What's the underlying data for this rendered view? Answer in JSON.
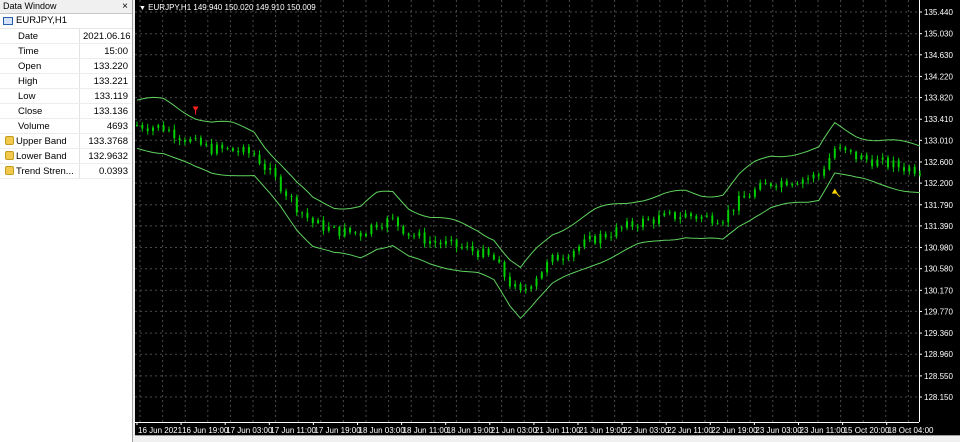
{
  "data_window": {
    "title": "Data Window",
    "close_label": "×",
    "symbol": "EURJPY,H1",
    "rows": [
      {
        "label": "Date",
        "value": "2021.06.16"
      },
      {
        "label": "Time",
        "value": "15:00"
      },
      {
        "label": "Open",
        "value": "133.220"
      },
      {
        "label": "High",
        "value": "133.221"
      },
      {
        "label": "Low",
        "value": "133.119"
      },
      {
        "label": "Close",
        "value": "133.136"
      },
      {
        "label": "Volume",
        "value": "4693"
      }
    ],
    "indicators": [
      {
        "label": "Upper Band",
        "value": "133.3768",
        "icon": "indicator-icon"
      },
      {
        "label": "Lower Band",
        "value": "132.9632",
        "icon": "indicator-icon"
      },
      {
        "label": "Trend Stren...",
        "value": "0.0393",
        "icon": "indicator-icon"
      }
    ]
  },
  "chart": {
    "header": "EURJPY,H1  149.940 150.020 149.910 150.009",
    "price_labels": [
      "135.440",
      "135.030",
      "134.630",
      "134.220",
      "133.820",
      "133.410",
      "133.010",
      "132.600",
      "132.200",
      "131.790",
      "131.390",
      "130.980",
      "130.580",
      "130.170",
      "129.770",
      "129.360",
      "128.960",
      "128.550",
      "128.150"
    ],
    "time_labels": [
      "16 Jun 2021",
      "16 Jun 19:00",
      "17 Jun 03:00",
      "17 Jun 11:00",
      "17 Jun 19:00",
      "18 Jun 03:00",
      "18 Jun 11:00",
      "18 Jun 19:00",
      "21 Jun 03:00",
      "21 Jun 11:00",
      "21 Jun 19:00",
      "22 Jun 03:00",
      "22 Jun 11:00",
      "22 Jun 19:00",
      "23 Jun 03:00",
      "23 Jun 11:00",
      "15 Oct 20:00",
      "18 Oct 04:00"
    ],
    "colors": {
      "background": "#000000",
      "grid": "#4a4a4a",
      "candle": "#00d000",
      "band": "#5fd35f",
      "axis_text": "#ffffff",
      "arrow_sell": "#ff2020",
      "arrow_buy": "#ffd700"
    }
  },
  "chart_data": {
    "type": "candlestick",
    "symbol": "EURJPY",
    "timeframe": "H1",
    "y_range": [
      128.15,
      135.44
    ],
    "grid": true,
    "center_path": [
      [
        0,
        133.3
      ],
      [
        5,
        133.25
      ],
      [
        8,
        133.1
      ],
      [
        11,
        132.95
      ],
      [
        14,
        132.85
      ],
      [
        18,
        132.82
      ],
      [
        22,
        132.75
      ],
      [
        24,
        132.5
      ],
      [
        27,
        132.15
      ],
      [
        30,
        131.75
      ],
      [
        33,
        131.45
      ],
      [
        37,
        131.3
      ],
      [
        42,
        131.25
      ],
      [
        45,
        131.45
      ],
      [
        48,
        131.5
      ],
      [
        51,
        131.25
      ],
      [
        55,
        131.1
      ],
      [
        60,
        131.0
      ],
      [
        64,
        130.9
      ],
      [
        67,
        130.75
      ],
      [
        70,
        130.3
      ],
      [
        72,
        130.1
      ],
      [
        75,
        130.45
      ],
      [
        78,
        130.75
      ],
      [
        82,
        130.95
      ],
      [
        86,
        131.15
      ],
      [
        90,
        131.3
      ],
      [
        94,
        131.45
      ],
      [
        99,
        131.55
      ],
      [
        103,
        131.6
      ],
      [
        106,
        131.55
      ],
      [
        110,
        131.55
      ],
      [
        113,
        131.85
      ],
      [
        116,
        132.05
      ],
      [
        119,
        132.2
      ],
      [
        122,
        132.25
      ],
      [
        126,
        132.3
      ],
      [
        128,
        132.35
      ],
      [
        131,
        132.85
      ],
      [
        135,
        132.7
      ],
      [
        139,
        132.6
      ],
      [
        144,
        132.5
      ],
      [
        147,
        132.45
      ]
    ],
    "band_half_width": 0.42,
    "signals": [
      {
        "type": "sell",
        "index": 11,
        "price": 133.65
      },
      {
        "type": "buy",
        "index": 131,
        "price": 132.0
      }
    ]
  }
}
